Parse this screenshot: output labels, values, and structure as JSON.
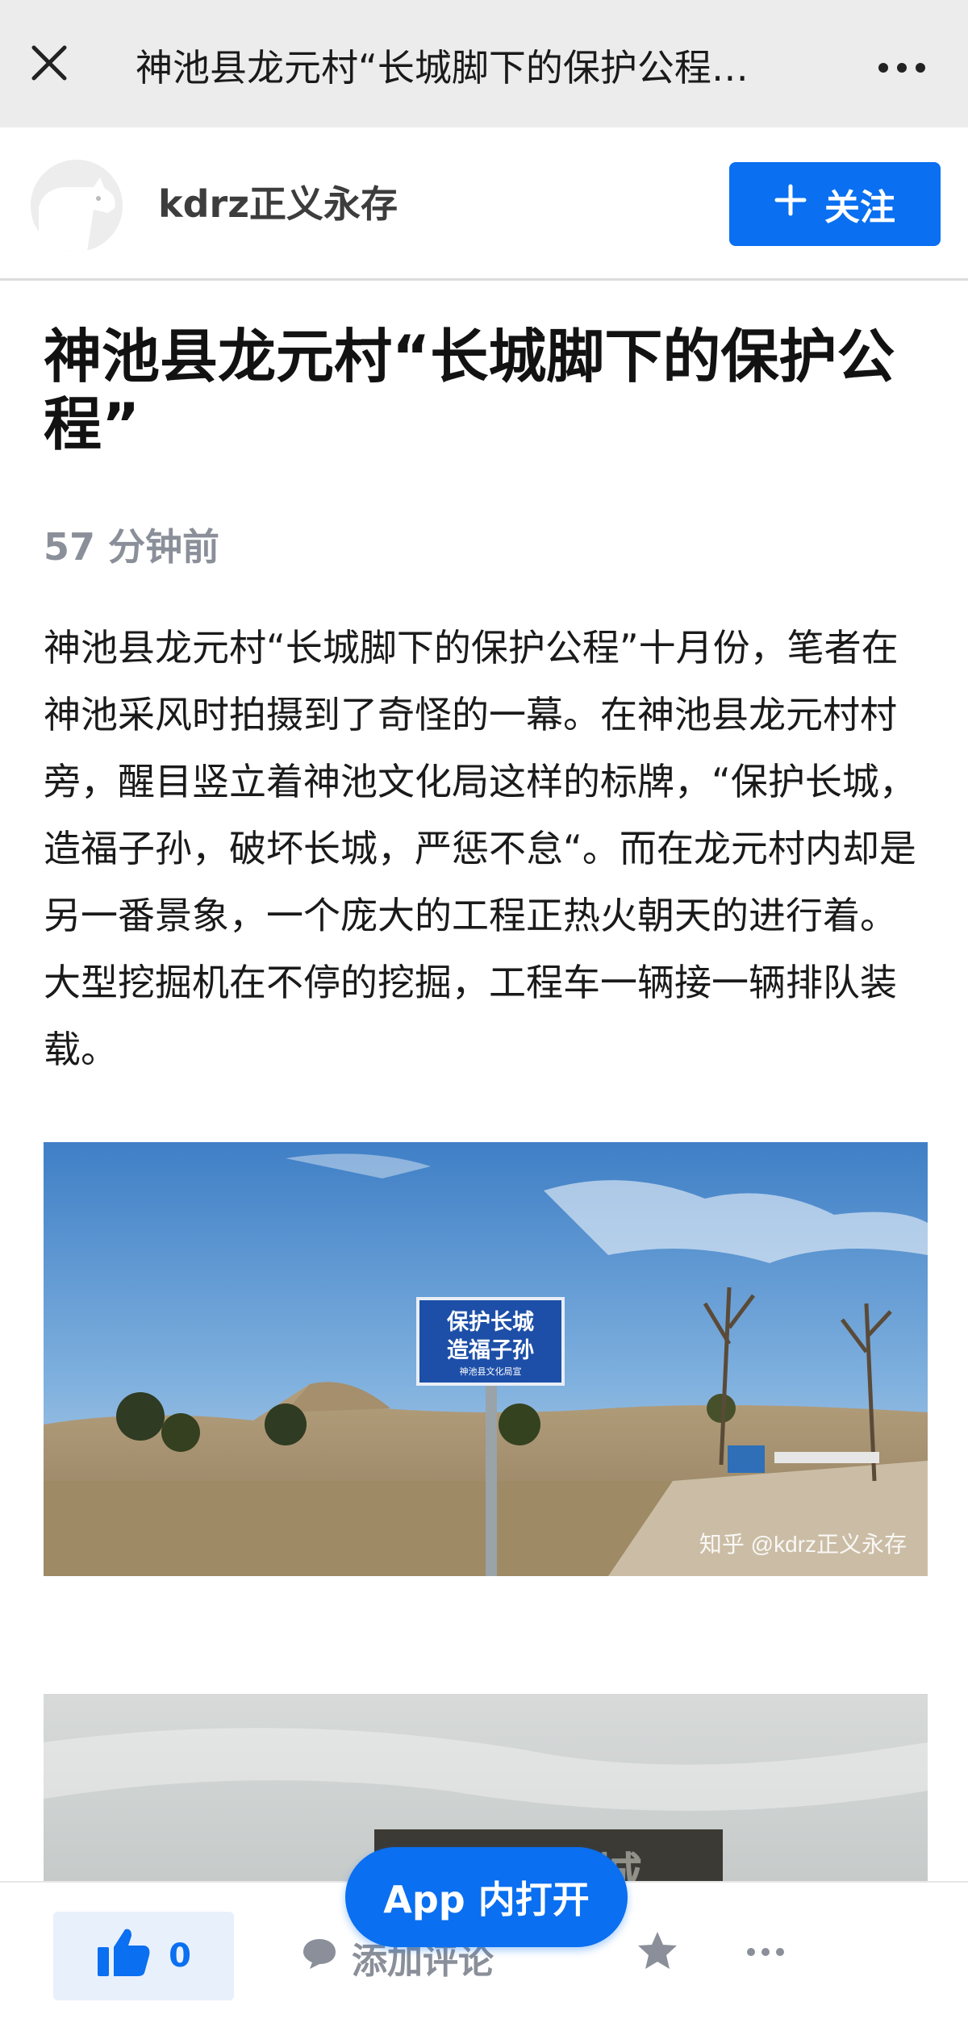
{
  "topbar": {
    "title": "神池县龙元村“长城脚下的保护公程…",
    "close_icon": "close-icon",
    "more_icon": "more-horizontal-icon"
  },
  "author": {
    "name": "kdrz正义永存",
    "follow_label": "关注",
    "follow_icon": "plus-icon"
  },
  "article": {
    "title": "神池县龙元村“长城脚下的保护公程”",
    "time": "57 分钟前",
    "paragraph": "神池县龙元村“长城脚下的保护公程”十月份，笔者在神池采风时拍摄到了奇怪的一幕。在神池县龙元村村旁，醒目竖立着神池文化局这样的标牌，“保护长城，造福子孙，破坏长城，严惩不怠“。而在龙元村内却是另一番景象，一个庞大的工程正热火朝天的进行着。大型挖掘机在不停的挖掘，工程车一辆接一辆排队装载。",
    "image1": {
      "sign_line1": "保护长城",
      "sign_line2": "造福子孙",
      "sign_small": "神池县文化局宣",
      "watermark": "知乎 @kdrz正义永存"
    },
    "image2": {
      "sign_text": "破坏长城"
    }
  },
  "bottombar": {
    "like_count": "0",
    "like_icon": "thumbs-up-icon",
    "comment_label": "添加评论",
    "comment_icon": "comment-icon",
    "star_icon": "star-icon",
    "more_icon": "more-horizontal-icon"
  },
  "app_open_label": "App 内打开",
  "colors": {
    "accent": "#0a6ff0",
    "topbar_bg": "#ececec",
    "muted": "#8a8f99"
  }
}
